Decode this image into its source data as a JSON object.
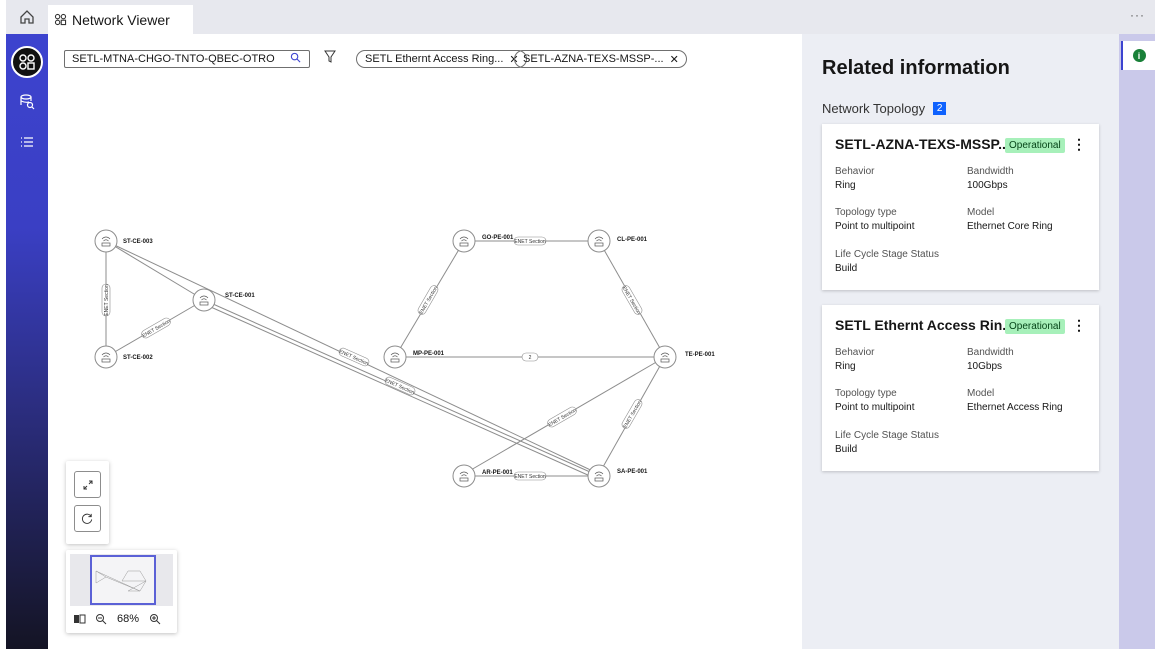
{
  "app": {
    "tab_label": "Network Viewer",
    "more_label": "···"
  },
  "rail": {
    "items": [
      "home-icon",
      "network-icon",
      "database-search-icon",
      "list-icon"
    ]
  },
  "toolbar": {
    "search_value": "SETL-MTNA-CHGO-TNTO-QBEC-OTRO",
    "chips": [
      "SETL Ethernt Access Ring...",
      "SETL-AZNA-TEXS-MSSP-..."
    ]
  },
  "graph": {
    "nodes": [
      "ST-CE-003",
      "ST-CE-001",
      "ST-CE-002",
      "GO-PE-001",
      "CL-PE-001",
      "MP-PE-001",
      "TE-PE-001",
      "AR-PE-001",
      "SA-PE-001"
    ],
    "edge_label": "ENET Section",
    "count_label": "2"
  },
  "zoom": {
    "level": "68%"
  },
  "panel": {
    "title": "Related information",
    "section": "Network Topology",
    "count": "2",
    "cards": [
      {
        "title": "SETL-AZNA-TEXS-MSSP...",
        "status": "Operational",
        "behavior_label": "Behavior",
        "behavior": "Ring",
        "bandwidth_label": "Bandwidth",
        "bandwidth": "100Gbps",
        "topology_label": "Topology type",
        "topology": "Point to multipoint",
        "model_label": "Model",
        "model": "Ethernet Core Ring",
        "lcs_label": "Life Cycle Stage Status",
        "lcs": "Build"
      },
      {
        "title": "SETL Ethernt Access Rin...",
        "status": "Operational",
        "behavior_label": "Behavior",
        "behavior": "Ring",
        "bandwidth_label": "Bandwidth",
        "bandwidth": "10Gbps",
        "topology_label": "Topology type",
        "topology": "Point to multipoint",
        "model_label": "Model",
        "model": "Ethernet Access Ring",
        "lcs_label": "Life Cycle Stage Status",
        "lcs": "Build"
      }
    ]
  },
  "colors": {
    "accent": "#3d44d0",
    "status_bg": "#a7f0ba",
    "badge": "#0f62fe",
    "info": "#198038"
  }
}
